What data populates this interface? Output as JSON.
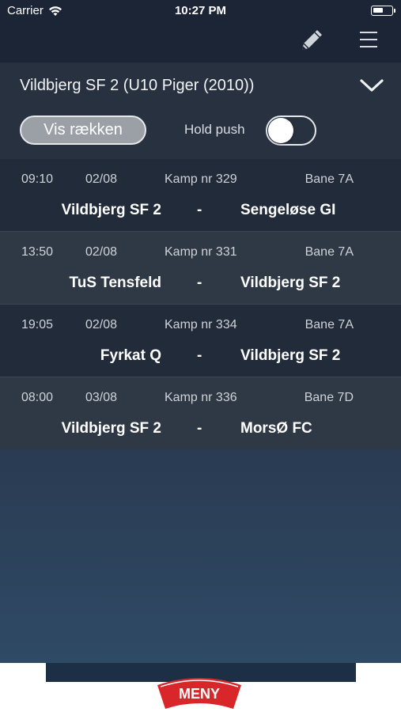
{
  "status_bar": {
    "carrier": "Carrier",
    "time": "10:27 PM"
  },
  "header": {
    "team_title": "Vildbjerg SF 2 (U10 Piger (2010))",
    "vis_button": "Vis rækken",
    "hold_push_label": "Hold push",
    "hold_push_on": false
  },
  "matches": [
    {
      "time": "09:10",
      "date": "02/08",
      "nr": "Kamp nr 329",
      "bane": "Bane 7A",
      "home": "Vildbjerg SF 2",
      "sep": "-",
      "away": "Sengeløse GI"
    },
    {
      "time": "13:50",
      "date": "02/08",
      "nr": "Kamp nr 331",
      "bane": "Bane 7A",
      "home": "TuS Tensfeld",
      "sep": "-",
      "away": "Vildbjerg SF 2"
    },
    {
      "time": "19:05",
      "date": "02/08",
      "nr": "Kamp nr 334",
      "bane": "Bane 7A",
      "home": "Fyrkat Q",
      "sep": "-",
      "away": "Vildbjerg SF 2"
    },
    {
      "time": "08:00",
      "date": "03/08",
      "nr": "Kamp nr 336",
      "bane": "Bane 7D",
      "home": "Vildbjerg SF 2",
      "sep": "-",
      "away": "MorsØ FC"
    }
  ],
  "ad": {
    "brand": "MENY"
  },
  "icons": {
    "edit": "pencil-icon",
    "menu": "hamburger-menu-icon",
    "expand": "chevron-down-icon",
    "wifi": "wifi-icon",
    "battery": "battery-icon"
  }
}
